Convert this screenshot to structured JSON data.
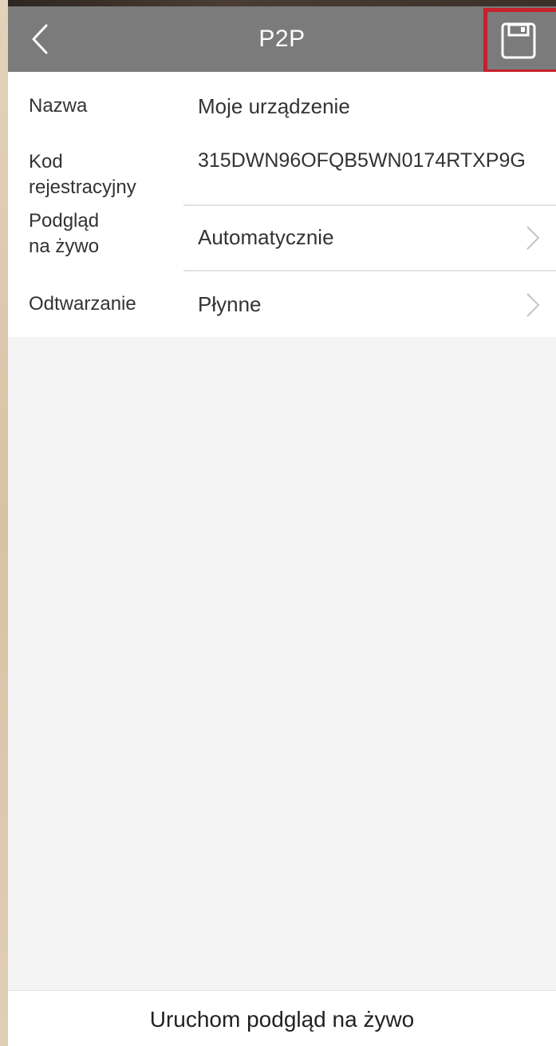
{
  "header": {
    "title": "P2P",
    "back_icon": "chevron-left-icon",
    "save_icon": "floppy-disk-icon",
    "background_color": "#7b7b7b",
    "highlight_color": "#c8202c"
  },
  "settings": {
    "name": {
      "label": "Nazwa",
      "value": "Moje urządzenie"
    },
    "registration_code": {
      "label_line1": "Kod",
      "label_line2": "rejestracyjny",
      "value": "315DWN96OFQB5WN0174RTXP9G"
    },
    "live_view": {
      "label_line1": "Podgląd",
      "label_line2": "na żywo",
      "value": "Automatycznie"
    },
    "playback": {
      "label": "Odtwarzanie",
      "value": "Płynne"
    }
  },
  "footer": {
    "start_live_view_label": "Uruchom podgląd na żywo"
  }
}
